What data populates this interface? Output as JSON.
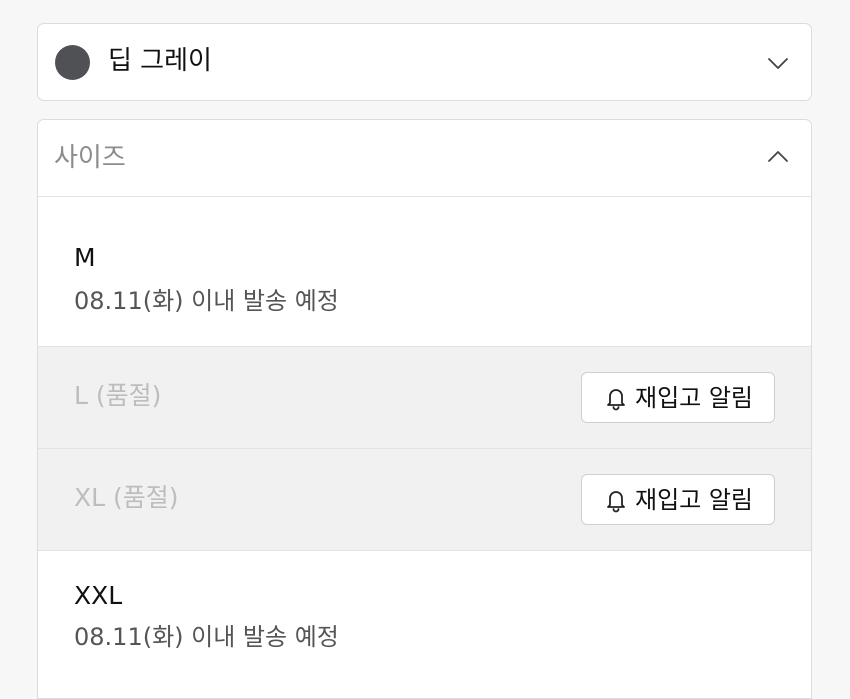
{
  "color_select": {
    "swatch_color": "#4f5154",
    "selected_label": "딥 그레이",
    "icon": "chevron-down-icon"
  },
  "size_select": {
    "header_label": "사이즈",
    "icon": "chevron-up-icon",
    "options": [
      {
        "name": "M",
        "status": "available",
        "shipping": "08.11(화) 이내 발송 예정"
      },
      {
        "name": "L (품절)",
        "status": "soldout",
        "button_label": "재입고 알림",
        "button_icon": "bell-icon"
      },
      {
        "name": "XL (품절)",
        "status": "soldout",
        "button_label": "재입고 알림",
        "button_icon": "bell-icon"
      },
      {
        "name": "XXL",
        "status": "available",
        "shipping": "08.11(화) 이내 발송 예정"
      }
    ]
  }
}
